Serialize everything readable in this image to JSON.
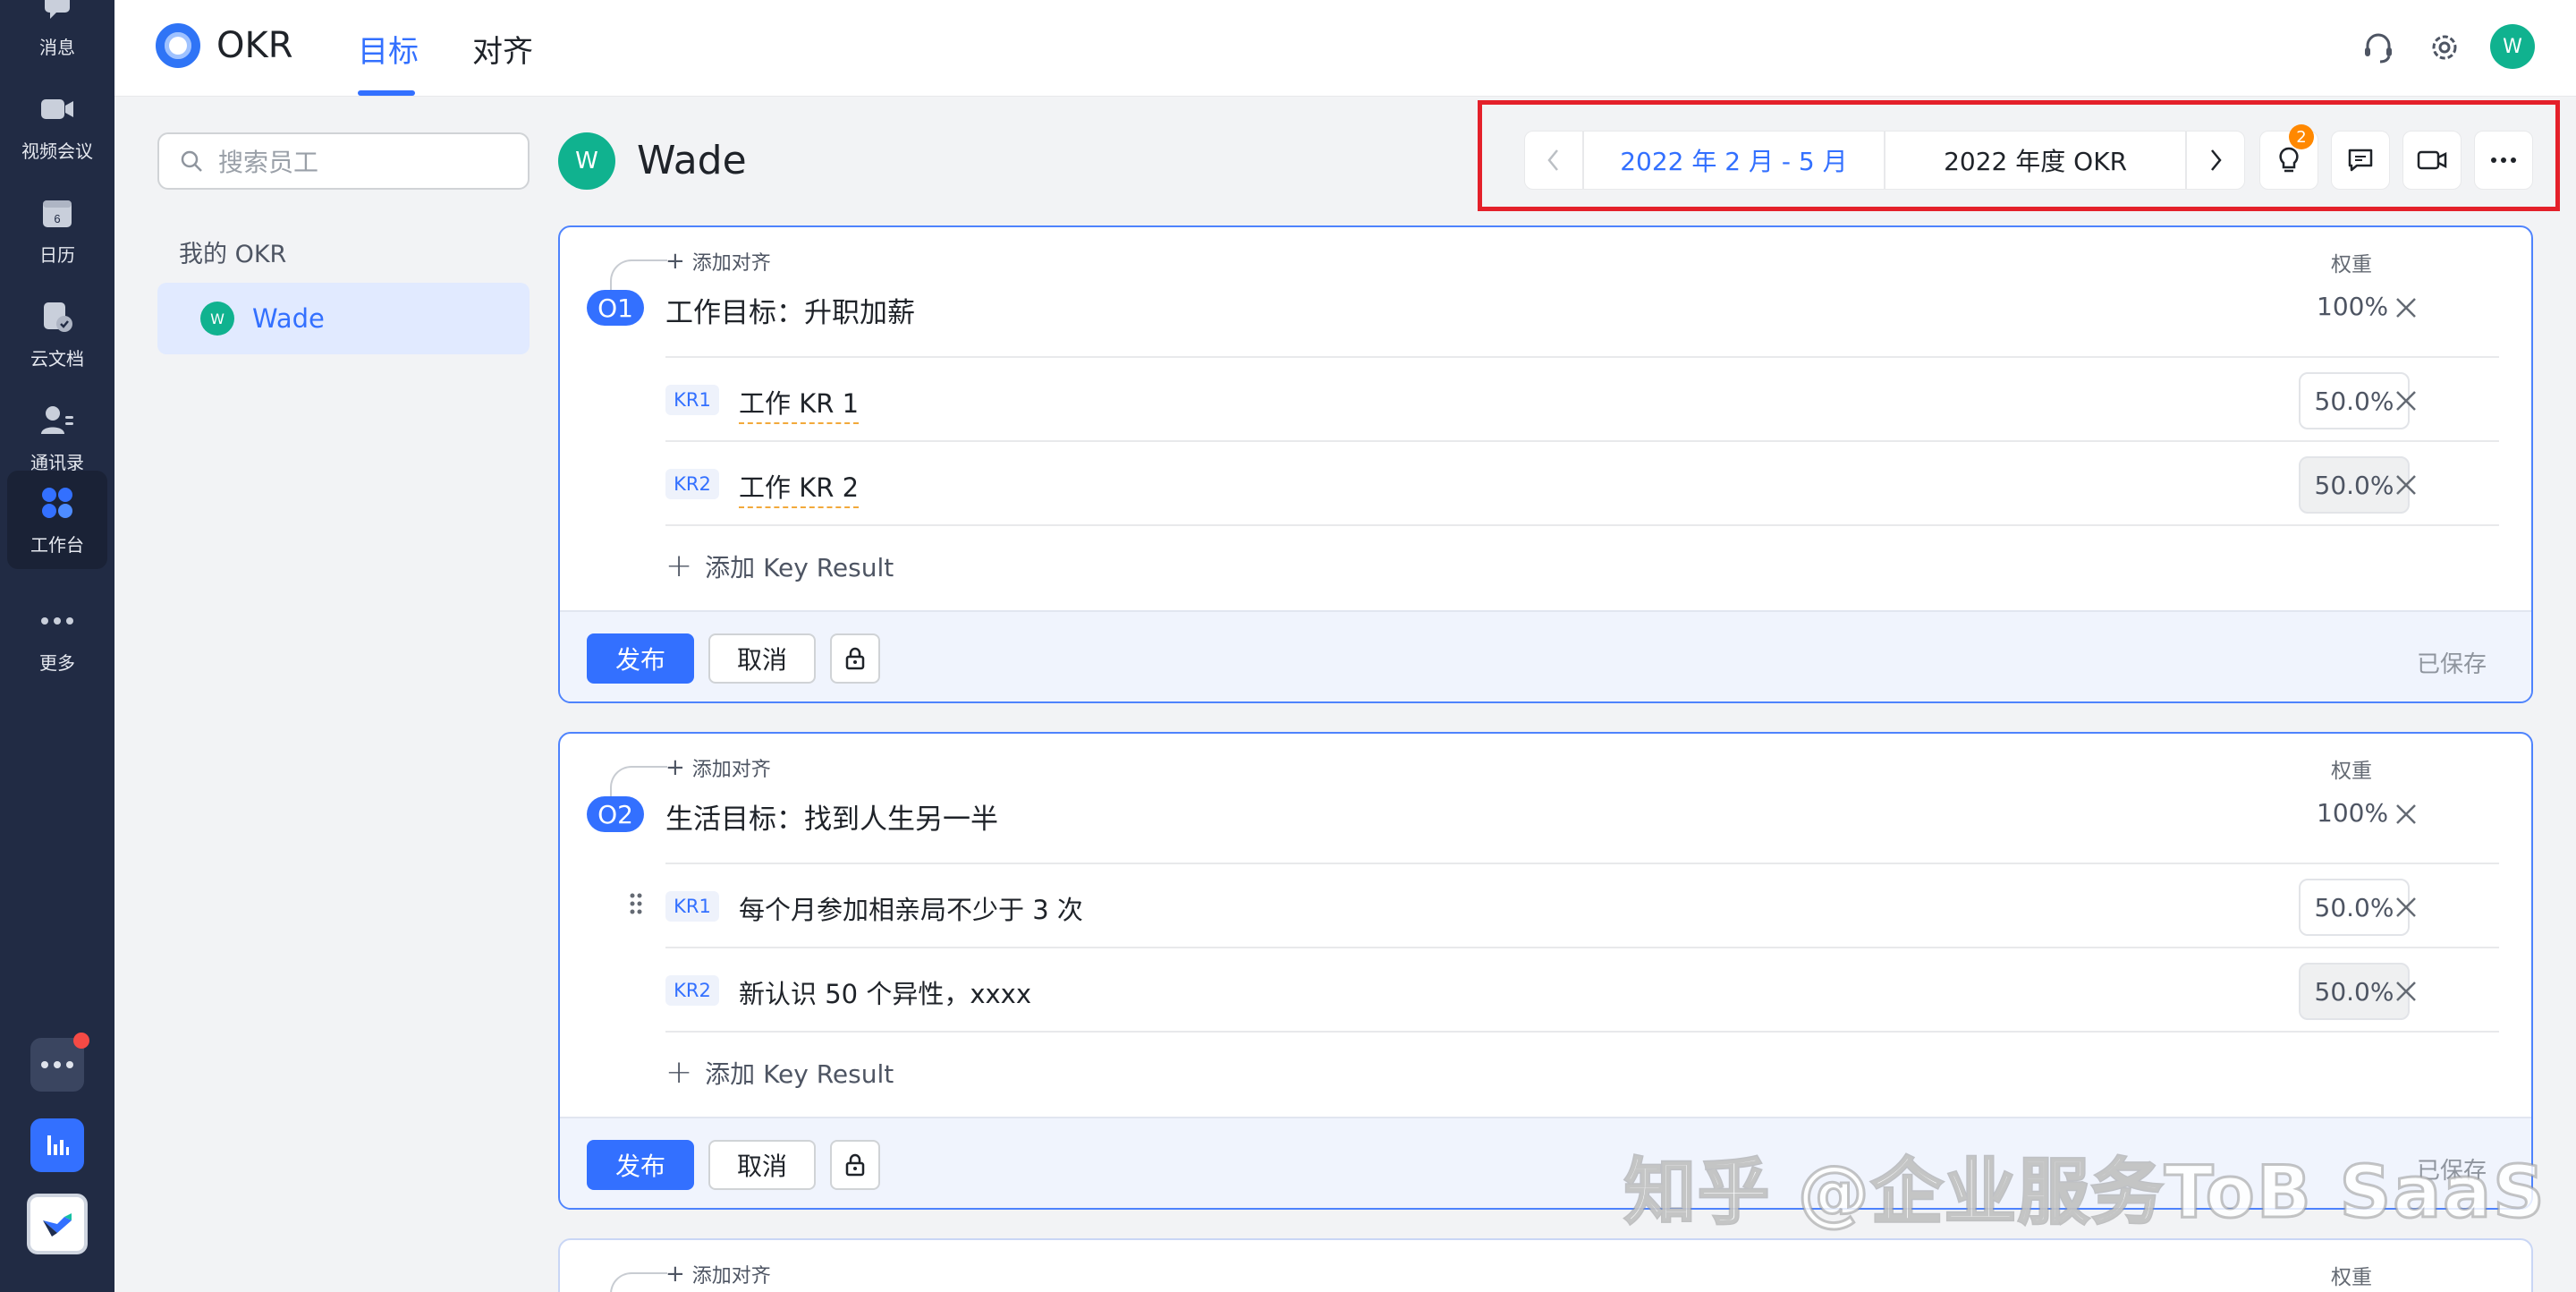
{
  "rail": {
    "items": [
      {
        "label": "消息",
        "icon": "message-icon"
      },
      {
        "label": "视频会议",
        "icon": "video-camera-icon"
      },
      {
        "label": "日历",
        "icon": "calendar-icon",
        "day": "6"
      },
      {
        "label": "云文档",
        "icon": "docs-icon"
      },
      {
        "label": "通讯录",
        "icon": "contacts-icon"
      },
      {
        "label": "工作台",
        "icon": "workplace-icon"
      },
      {
        "label": "更多",
        "icon": "more-icon"
      }
    ],
    "active": "工作台"
  },
  "app": {
    "name": "OKR"
  },
  "nav": {
    "tabs": [
      {
        "label": "目标"
      },
      {
        "label": "对齐"
      }
    ],
    "active": "目标"
  },
  "user_initial": "W",
  "sidebar": {
    "search_placeholder": "搜索员工",
    "section_label": "我的 OKR",
    "member": {
      "initial": "W",
      "name": "Wade"
    }
  },
  "header": {
    "initial": "W",
    "name": "Wade"
  },
  "toolbar": {
    "period": "2022 年 2 月 - 5 月",
    "cycle": "2022 年度 OKR",
    "tips_badge": "2"
  },
  "labels": {
    "add_align": "添加对齐",
    "weight": "权重",
    "add_kr": "添加 Key Result",
    "publish": "发布",
    "cancel": "取消",
    "saved": "已保存"
  },
  "objectives": [
    {
      "badge": "O1",
      "title": "工作目标：升职加薪",
      "weight": "100%",
      "krs": [
        {
          "badge": "KR1",
          "text": "工作 KR 1",
          "weight": "50.0%"
        },
        {
          "badge": "KR2",
          "text": "工作 KR 2",
          "weight": "50.0%"
        }
      ]
    },
    {
      "badge": "O2",
      "title": "生活目标：找到人生另一半",
      "weight": "100%",
      "krs": [
        {
          "badge": "KR1",
          "text": "每个月参加相亲局不少于 3 次",
          "weight": "50.0%"
        },
        {
          "badge": "KR2",
          "text": "新认识 50 个异性，xxxx",
          "weight": "50.0%"
        }
      ]
    }
  ],
  "watermark": "知乎 @企业服务ToB SaaS",
  "colors": {
    "accent": "#3370ff",
    "rail": "#212b44",
    "avatar": "#10b28f",
    "badge": "#ff8800",
    "highlight": "#e4202a"
  }
}
